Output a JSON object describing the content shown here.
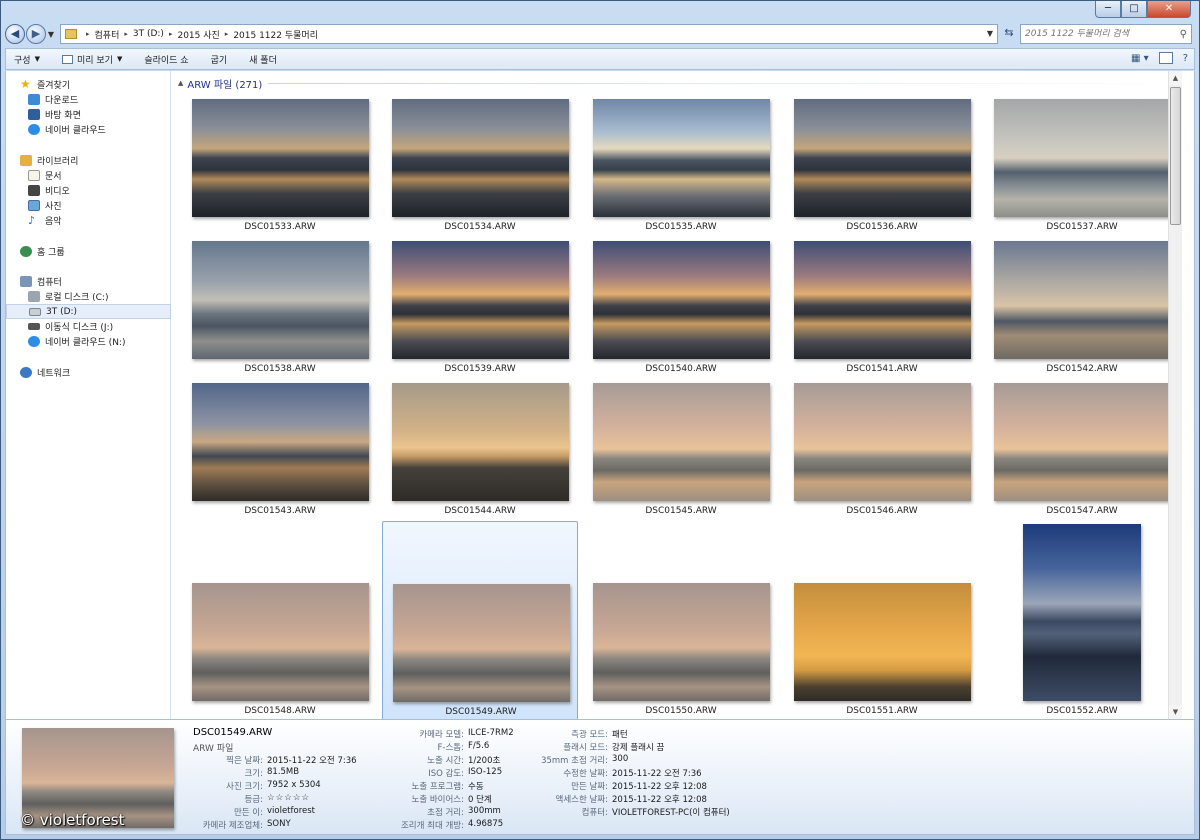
{
  "window": {
    "min": "─",
    "max": "□",
    "close": "✕"
  },
  "nav": {
    "breadcrumb": [
      "컴퓨터",
      "3T (D:)",
      "2015 사진",
      "2015 1122 두물머리"
    ],
    "search_placeholder": "2015 1122 두물머리 검색"
  },
  "toolbar": {
    "organize": "구성",
    "preview": "미리 보기",
    "slideshow": "슬라이드 쇼",
    "burn": "굽기",
    "new_folder": "새 폴더"
  },
  "sidebar": {
    "favorites": {
      "label": "즐겨찾기",
      "items": [
        "다운로드",
        "바탕 화면",
        "네이버 클라우드"
      ]
    },
    "libraries": {
      "label": "라이브러리",
      "items": [
        "문서",
        "비디오",
        "사진",
        "음악"
      ]
    },
    "homegroup": "홈 그룹",
    "computer": {
      "label": "컴퓨터",
      "items": [
        "로컬 디스크 (C:)",
        "3T (D:)",
        "이동식 디스크 (J:)",
        "네이버 클라우드 (N:)"
      ]
    },
    "network": "네트워크"
  },
  "group": {
    "title": "ARW 파일 (271)"
  },
  "files": [
    {
      "name": "DSC01533.ARW",
      "tone": "dusk"
    },
    {
      "name": "DSC01534.ARW",
      "tone": "dusk"
    },
    {
      "name": "DSC01535.ARW",
      "tone": "bright"
    },
    {
      "name": "DSC01536.ARW",
      "tone": "dusk"
    },
    {
      "name": "DSC01537.ARW",
      "tone": "pale"
    },
    {
      "name": "DSC01538.ARW",
      "tone": "grey"
    },
    {
      "name": "DSC01539.ARW",
      "tone": "vivid"
    },
    {
      "name": "DSC01540.ARW",
      "tone": "vivid"
    },
    {
      "name": "DSC01541.ARW",
      "tone": "vivid"
    },
    {
      "name": "DSC01542.ARW",
      "tone": "boat"
    },
    {
      "name": "DSC01543.ARW",
      "tone": "boat2"
    },
    {
      "name": "DSC01544.ARW",
      "tone": "gold"
    },
    {
      "name": "DSC01545.ARW",
      "tone": "amber"
    },
    {
      "name": "DSC01546.ARW",
      "tone": "amber"
    },
    {
      "name": "DSC01547.ARW",
      "tone": "amber"
    },
    {
      "name": "DSC01548.ARW",
      "tone": "mist"
    },
    {
      "name": "DSC01549.ARW",
      "tone": "mist",
      "selected": true
    },
    {
      "name": "DSC01550.ARW",
      "tone": "mist"
    },
    {
      "name": "DSC01551.ARW",
      "tone": "orange"
    },
    {
      "name": "DSC01552.ARW",
      "tone": "tall"
    }
  ],
  "details": {
    "name": "DSC01549.ARW",
    "type": "ARW 파일",
    "col1": [
      {
        "label": "찍은 날짜:",
        "value": "2015-11-22 오전 7:36"
      },
      {
        "label": "크기:",
        "value": "81.5MB"
      },
      {
        "label": "사진 크기:",
        "value": "7952 x 5304"
      },
      {
        "label": "등급:",
        "value": "☆☆☆☆☆"
      },
      {
        "label": "만든 이:",
        "value": "violetforest"
      },
      {
        "label": "카메라 제조업체:",
        "value": "SONY"
      }
    ],
    "col2": [
      {
        "label": "카메라 모델:",
        "value": "ILCE-7RM2"
      },
      {
        "label": "F-스톱:",
        "value": "F/5.6"
      },
      {
        "label": "노출 시간:",
        "value": "1/200초"
      },
      {
        "label": "ISO 감도:",
        "value": "ISO-125"
      },
      {
        "label": "노출 프로그램:",
        "value": "수동"
      },
      {
        "label": "노출 바이어스:",
        "value": "0 단계"
      },
      {
        "label": "초점 거리:",
        "value": "300mm"
      },
      {
        "label": "조리개 최대 개방:",
        "value": "4.96875"
      }
    ],
    "col3": [
      {
        "label": "측광 모드:",
        "value": "패턴"
      },
      {
        "label": "플래시 모드:",
        "value": "강제 플래시 끔"
      },
      {
        "label": "35mm 초점 거리:",
        "value": "300"
      },
      {
        "label": "수정한 날짜:",
        "value": "2015-11-22 오전 7:36"
      },
      {
        "label": "만든 날짜:",
        "value": "2015-11-22 오후 12:08"
      },
      {
        "label": "액세스한 날짜:",
        "value": "2015-11-22 오후 12:08"
      },
      {
        "label": "컴퓨터:",
        "value": "VIOLETFOREST-PC(이 컴퓨터)"
      }
    ],
    "watermark": "© violetforest"
  }
}
